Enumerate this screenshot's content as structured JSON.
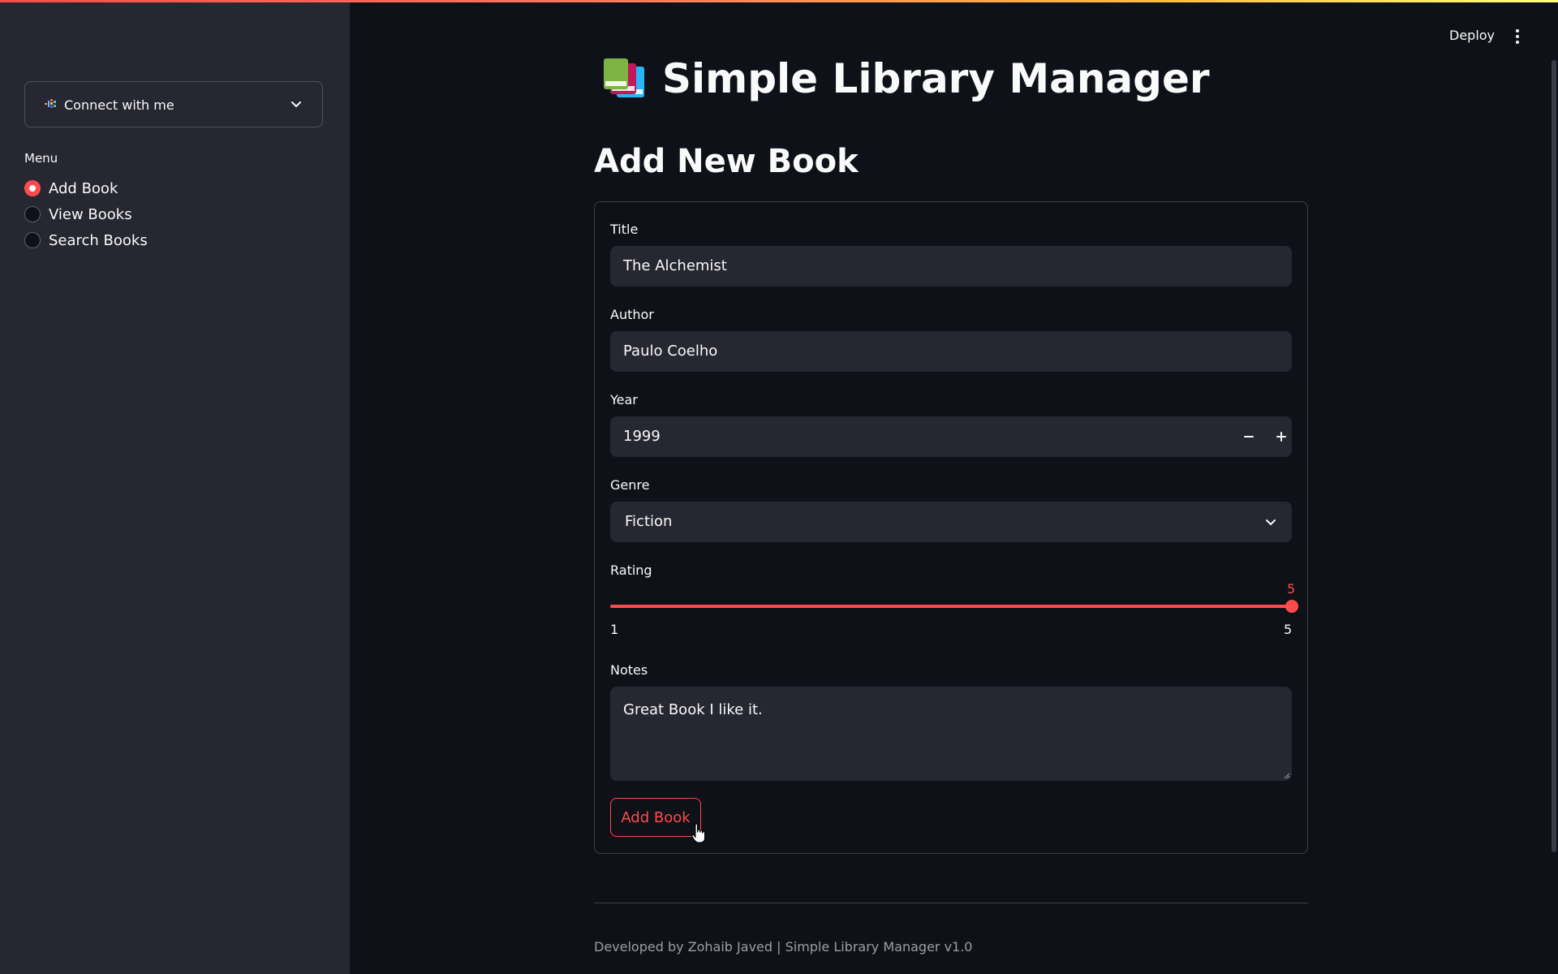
{
  "header": {
    "deploy_label": "Deploy",
    "menu_icon": "vertical-dots-icon"
  },
  "sidebar": {
    "expander": {
      "label": "Connect with me",
      "icon": "connect-icon",
      "chevron": "chevron-down-icon"
    },
    "menu_label": "Menu",
    "options": [
      {
        "label": "Add Book",
        "selected": true
      },
      {
        "label": "View Books",
        "selected": false
      },
      {
        "label": "Search Books",
        "selected": false
      }
    ]
  },
  "main": {
    "app_title": "Simple Library Manager",
    "title_icon": "books-icon",
    "section_title": "Add New Book",
    "form": {
      "title_label": "Title",
      "title_value": "The Alchemist",
      "author_label": "Author",
      "author_value": "Paulo Coelho",
      "year_label": "Year",
      "year_value": "1999",
      "genre_label": "Genre",
      "genre_value": "Fiction",
      "rating_label": "Rating",
      "rating_value": "5",
      "rating_min": "1",
      "rating_max": "5",
      "notes_label": "Notes",
      "notes_value": "Great Book I like it.",
      "submit_label": "Add Book"
    },
    "footer": "Developed by Zohaib Javed | Simple Library Manager v1.0"
  },
  "colors": {
    "accent": "#ff4b4b",
    "background": "#0e1117",
    "sidebar": "#262730",
    "input": "#262730",
    "text": "#fafafa"
  }
}
